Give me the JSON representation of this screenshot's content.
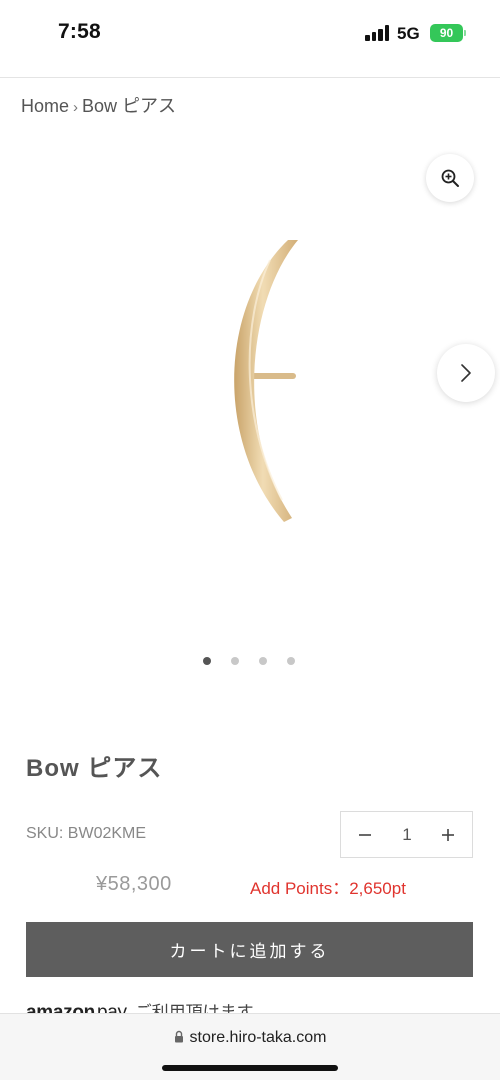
{
  "status_bar": {
    "time": "7:58",
    "network": "5G",
    "battery": "90"
  },
  "breadcrumb": {
    "home": "Home",
    "separator": "›",
    "current": "Bow ピアス"
  },
  "gallery": {
    "zoom_icon": "zoom-in-icon",
    "next_icon": "chevron-right-icon",
    "image_count": 4,
    "active_index": 0,
    "image_color": "#e2c79b"
  },
  "product": {
    "title": "Bow ピアス",
    "sku": "SKU: BW02KME",
    "quantity": "1",
    "price": "¥58,300",
    "points": "Add Points：2,650pt",
    "points_color": "#e0342e",
    "add_to_cart": "カートに追加する"
  },
  "amazon_pay": {
    "logo_brand": "amazon",
    "logo_pay": "pay",
    "note": "ご利用頂けます"
  },
  "browser": {
    "url": "store.hiro-taka.com"
  }
}
